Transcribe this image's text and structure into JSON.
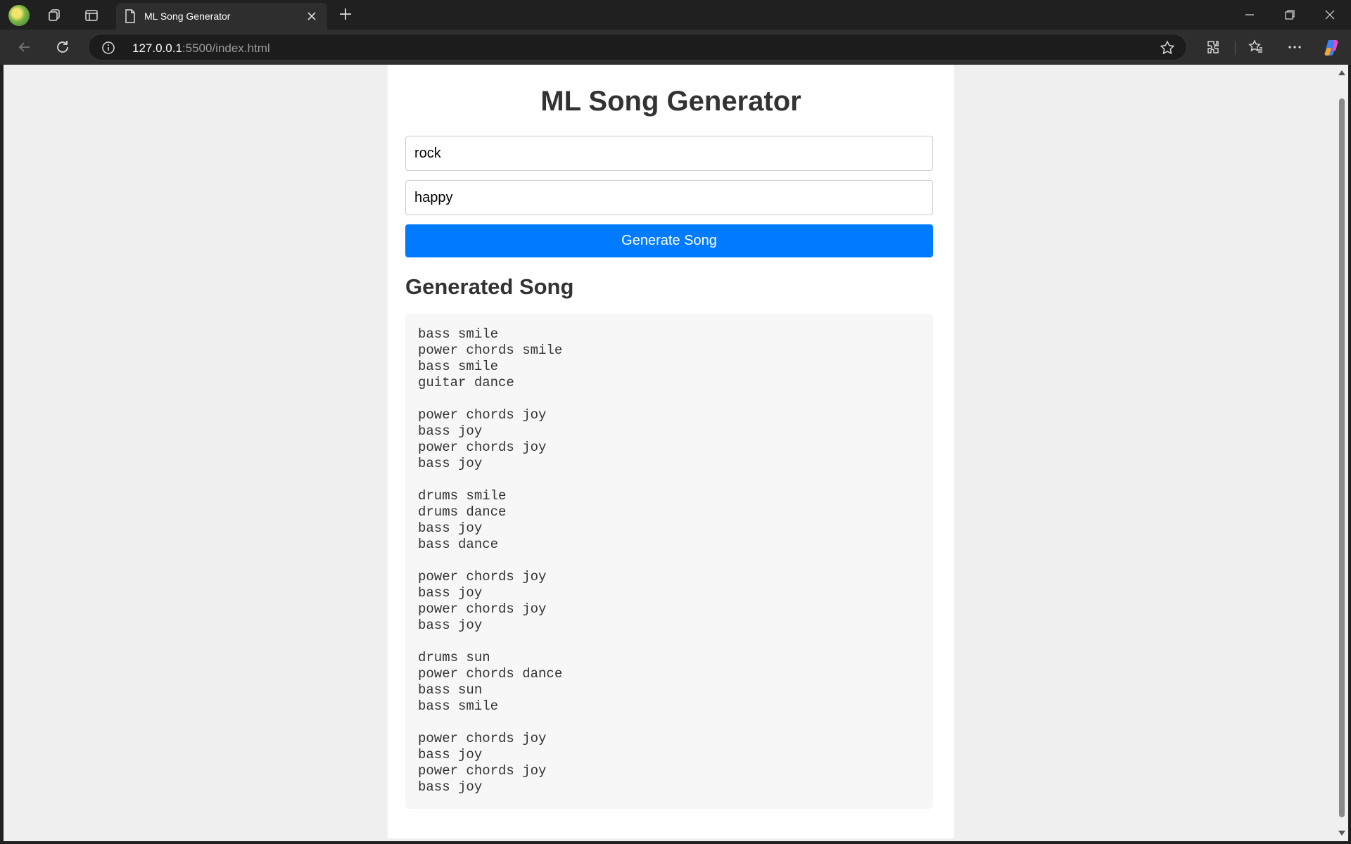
{
  "browser": {
    "tab_title": "ML Song Generator",
    "url_host": "127.0.0.1",
    "url_rest": ":5500/index.html"
  },
  "page": {
    "title": "ML Song Generator",
    "genre_value": "rock",
    "mood_value": "happy",
    "generate_label": "Generate Song",
    "result_heading": "Generated Song",
    "song": "bass smile\npower chords smile\nbass smile\nguitar dance\n\npower chords joy\nbass joy\npower chords joy\nbass joy\n\ndrums smile\ndrums dance\nbass joy\nbass dance\n\npower chords joy\nbass joy\npower chords joy\nbass joy\n\ndrums sun\npower chords dance\nbass sun\nbass smile\n\npower chords joy\nbass joy\npower chords joy\nbass joy"
  },
  "colors": {
    "accent": "#007bff",
    "page_bg": "#efefef",
    "card_bg": "#ffffff",
    "song_bg": "#f7f7f7"
  }
}
